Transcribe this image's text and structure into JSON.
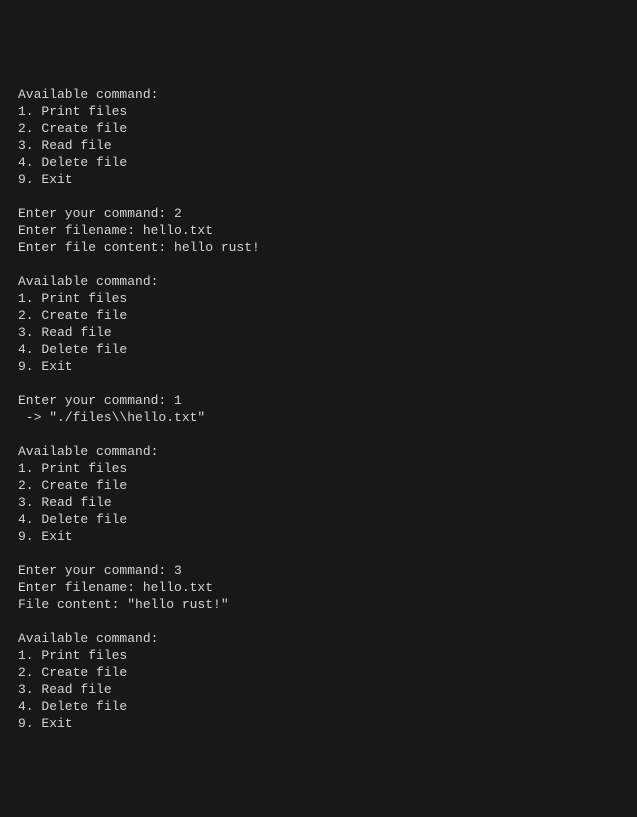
{
  "terminal": {
    "blocks": [
      {
        "menu_header": "Available command:",
        "menu_items": [
          "1. Print files",
          "2. Create file",
          "3. Read file",
          "4. Delete file",
          "9. Exit"
        ],
        "interactions": [
          "Enter your command: 2",
          "Enter filename: hello.txt",
          "Enter file content: hello rust!"
        ]
      },
      {
        "menu_header": "Available command:",
        "menu_items": [
          "1. Print files",
          "2. Create file",
          "3. Read file",
          "4. Delete file",
          "9. Exit"
        ],
        "interactions": [
          "Enter your command: 1",
          " -> \"./files\\\\hello.txt\""
        ]
      },
      {
        "menu_header": "Available command:",
        "menu_items": [
          "1. Print files",
          "2. Create file",
          "3. Read file",
          "4. Delete file",
          "9. Exit"
        ],
        "interactions": [
          "Enter your command: 3",
          "Enter filename: hello.txt",
          "File content: \"hello rust!\""
        ]
      },
      {
        "menu_header": "Available command:",
        "menu_items": [
          "1. Print files",
          "2. Create file",
          "3. Read file",
          "4. Delete file",
          "9. Exit"
        ],
        "interactions": []
      }
    ]
  }
}
